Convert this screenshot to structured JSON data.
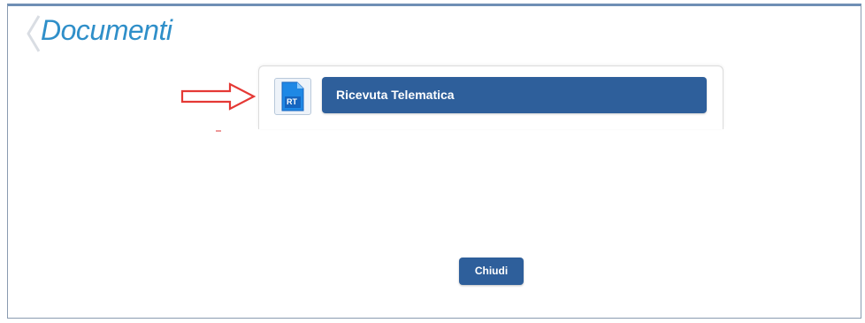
{
  "page": {
    "title": "Documenti"
  },
  "documents": [
    {
      "icon": "rt-document-icon",
      "icon_text": "RT",
      "label": "Ricevuta Telematica"
    }
  ],
  "annotations": {
    "pointer": "red-outline-arrow-icon"
  },
  "footer": {
    "close_label": "Chiudi"
  },
  "colors": {
    "title": "#2f8fc9",
    "button_bg": "#2e5f9b",
    "button_text": "#ffffff",
    "frame_border": "#8a9bb0",
    "arrow": "#e53935"
  }
}
